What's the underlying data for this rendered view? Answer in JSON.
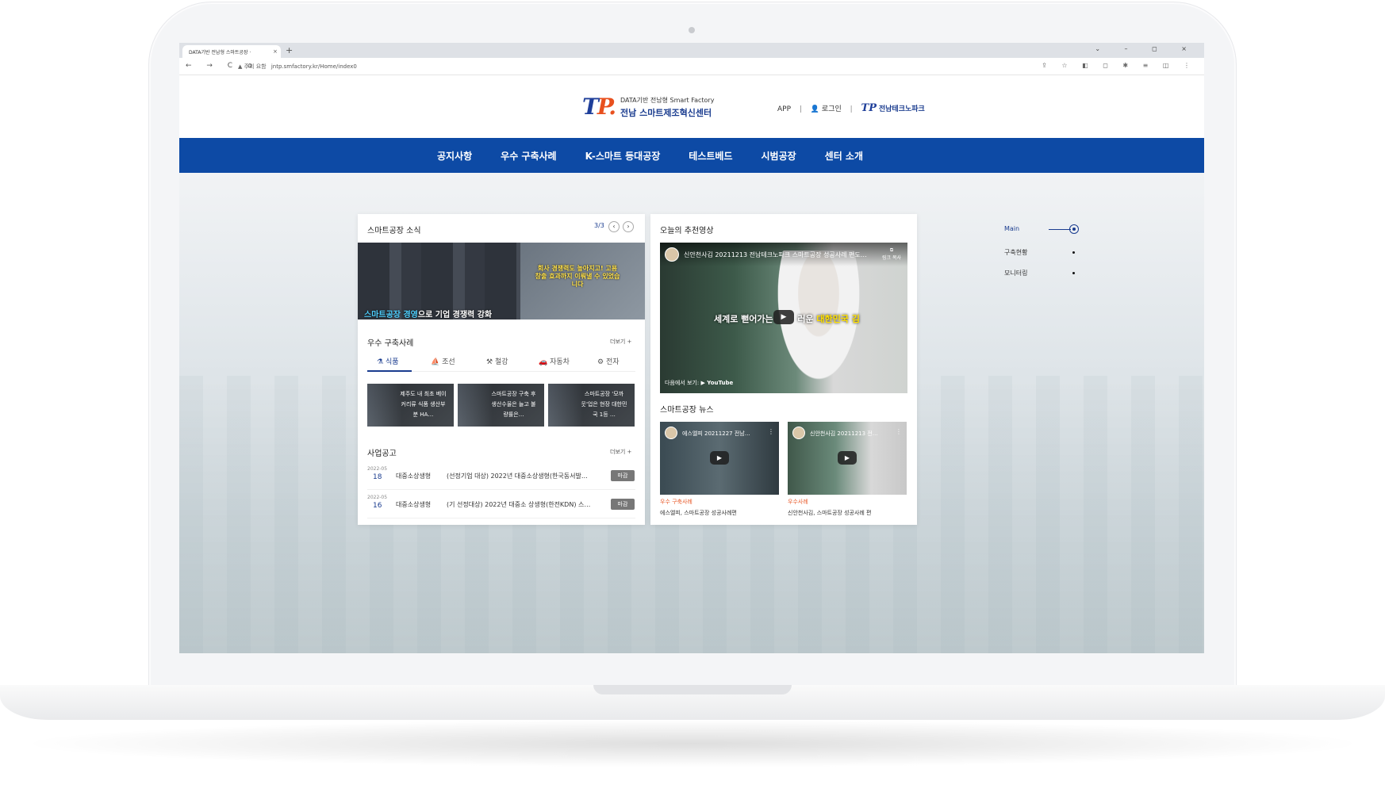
{
  "browser": {
    "tab_title": "DATA기반 전남형 스마트공장 ·",
    "tab_close": "×",
    "new_tab": "+",
    "window_controls": "⌄ – ◻ ×",
    "nav_buttons": "← → C ⌂",
    "security_warning": "▲ 주의 요함",
    "url": "jntp.smfactory.kr/Home/index0",
    "addr_icons": "⇪ ☆ ◧ ◻ ✱ ≡ ◫ ⋮"
  },
  "header": {
    "logo_mark_t": "T",
    "logo_mark_p": "P.",
    "logo_subtitle": "DATA기반 전남형 Smart Factory",
    "logo_title": "전남 스마트제조혁신센터",
    "util_app": "APP",
    "util_sep": "|",
    "util_login": "로그인",
    "util_login_icon": "👤",
    "util_brand_mark": "TP",
    "util_brand": "전남테크노파크"
  },
  "nav": {
    "items": [
      "공지사항",
      "우수 구축사례",
      "K-스마트 등대공장",
      "테스트베드",
      "시범공장",
      "센터 소개"
    ]
  },
  "news": {
    "title": "스마트공장 소식",
    "pager": "3/3",
    "prev": "‹",
    "next": "›",
    "banner_quote": "회사 경쟁력도 높아지고! 고용 창출 효과까지 이뤄낼 수 있었습니다",
    "banner_caption_hl": "스마트공장 경영",
    "banner_caption_rest": "으로 기업 경쟁력 강화"
  },
  "cases": {
    "title": "우수 구축사례",
    "more": "더보기 +",
    "tabs": [
      {
        "icon": "⚗",
        "label": "식품"
      },
      {
        "icon": "⛵",
        "label": "조선"
      },
      {
        "icon": "⚒",
        "label": "철강"
      },
      {
        "icon": "🚗",
        "label": "자동차"
      },
      {
        "icon": "⚙",
        "label": "전자"
      }
    ],
    "cards": [
      "제주도 내 최초 베이커리류 식품 생산부분 HA…",
      "스마트공장 구축 후 생산수율은 늘고 불량률은…",
      "스마트공장 '모까웃'업은 현장 대한민국 1등 …"
    ]
  },
  "notices": {
    "title": "사업공고",
    "more": "더보기 +",
    "rows": [
      {
        "date_small": "2022-05",
        "day": "18",
        "category": "대중소상생형",
        "title": "(선정기업 대상) 2022년 대중소상생형(한국동서발…",
        "status": "마감"
      },
      {
        "date_small": "2022-05",
        "day": "16",
        "category": "대중소상생형",
        "title": "(기 선정대상) 2022년 대중소 상생형(한전KDN) 스…",
        "status": "마감"
      }
    ]
  },
  "video": {
    "title": "오늘의 추천영상",
    "main_title": "신안천사김 20211213 전남테크노파크 스마트공장 성공사례 편도…",
    "copy_label": "링크 복사",
    "copy_icon": "⧉",
    "subtitle_white": "세계로 뻗어가는",
    "subtitle_white2": "러운",
    "subtitle_yellow": "대한민국 김",
    "play": "▶",
    "watch_on": "다음에서 보기:",
    "youtube": "▶ YouTube"
  },
  "news_videos": {
    "title": "스마트공장 뉴스",
    "items": [
      {
        "thumb_title": "에스엘피 20211227 전남…",
        "category": "우수 구축사례",
        "caption": "에스엘피, 스마트공장 성공사례편"
      },
      {
        "thumb_title": "신안천사김 20211213 전…",
        "category": "우수사례",
        "caption": "신안천사김, 스마트공장 성공사례 편"
      }
    ],
    "dots": "⋮",
    "play": "▶"
  },
  "side_nav": {
    "items": [
      "Main",
      "구축현황",
      "모니터링"
    ]
  },
  "colors": {
    "brand_blue": "#0d4aa5",
    "accent_orange": "#e85a2a",
    "logo_orange": "#e8501e"
  }
}
